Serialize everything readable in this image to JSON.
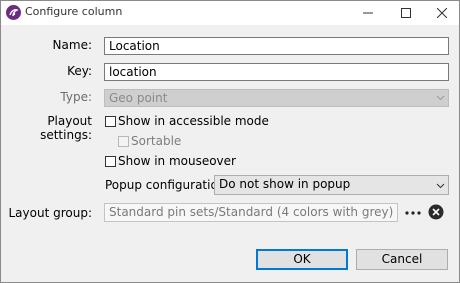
{
  "window": {
    "title": "Configure column"
  },
  "form": {
    "name_label": "Name:",
    "name_value": "Location",
    "key_label": "Key:",
    "key_value": "location",
    "type_label": "Type:",
    "type_value": "Geo point",
    "playout_label": "Playout settings:",
    "accessible_label": "Show in accessible mode",
    "accessible_checked": false,
    "sortable_label": "Sortable",
    "sortable_checked": false,
    "mouseover_label": "Show in mouseover",
    "mouseover_checked": false,
    "popup_label": "Popup configuration:",
    "popup_value": "Do not show in popup",
    "layout_group_label": "Layout group:",
    "layout_group_value": "Standard pin sets/Standard (4 colors with grey)"
  },
  "buttons": {
    "ok_label": "OK",
    "cancel_label": "Cancel"
  },
  "icons": {
    "app": "app-logo-icon",
    "minimize": "minimize-icon",
    "maximize": "maximize-icon",
    "close": "close-icon",
    "more": "ellipsis-icon",
    "clear": "clear-circle-icon"
  },
  "colors": {
    "accent": "#0078d7",
    "app_icon": "#6b2d83"
  }
}
